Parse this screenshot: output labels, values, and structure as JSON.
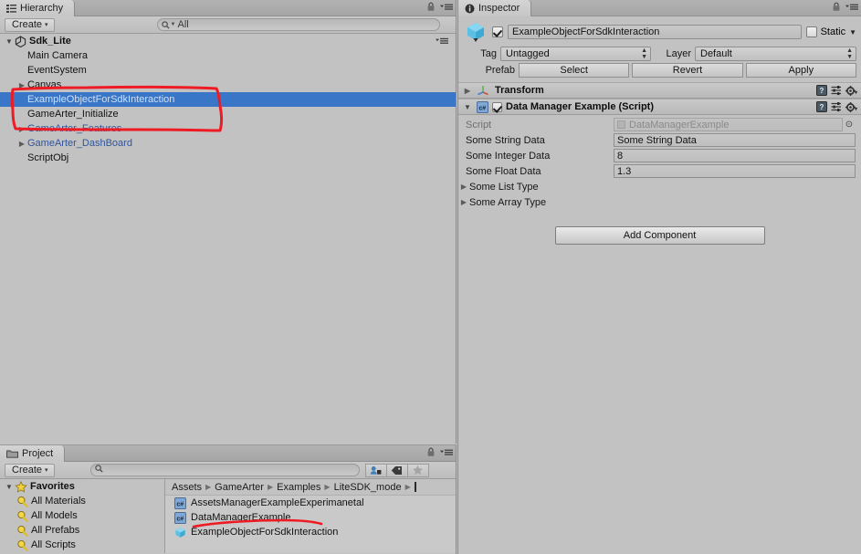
{
  "theme": {
    "accent": "#3a76c8",
    "prefab_text": "#30559a",
    "annotation": "#ee1b24",
    "bg": "#c2c2c2"
  },
  "hierarchy": {
    "tab_label": "Hierarchy",
    "tab_icon": "hierarchy-icon",
    "lock_icon": "lock-icon",
    "menu_icon": "hamburger-menu-icon",
    "create_label": "Create",
    "create_caret": "▾",
    "search_placeholder": "",
    "search_value": "All",
    "search_icon": "search-dropdown-icon",
    "scene_menu_icon": "hamburger-menu-icon",
    "root": {
      "label": "Sdk_Lite",
      "icon": "unity-scene-icon",
      "expanded": true,
      "foldout": "▼"
    },
    "items": [
      {
        "label": "Main Camera",
        "foldout": "",
        "indent": 1,
        "prefab": false,
        "selected": false
      },
      {
        "label": "EventSystem",
        "foldout": "",
        "indent": 1,
        "prefab": false,
        "selected": false
      },
      {
        "label": "Canvas",
        "foldout": "▶",
        "indent": 1,
        "prefab": false,
        "selected": false
      },
      {
        "label": "ExampleObjectForSdkInteraction",
        "foldout": "",
        "indent": 1,
        "prefab": true,
        "selected": true
      },
      {
        "label": "GameArter_Initialize",
        "foldout": "",
        "indent": 1,
        "prefab": false,
        "selected": false
      },
      {
        "label": "GameArter_Features",
        "foldout": "▶",
        "indent": 1,
        "prefab": true,
        "selected": false
      },
      {
        "label": "GameArter_DashBoard",
        "foldout": "▶",
        "indent": 1,
        "prefab": true,
        "selected": false
      },
      {
        "label": "ScriptObj",
        "foldout": "",
        "indent": 1,
        "prefab": false,
        "selected": false
      }
    ]
  },
  "inspector": {
    "tab_label": "Inspector",
    "tab_icon": "info-icon",
    "lock_icon": "lock-icon",
    "menu_icon": "hamburger-menu-icon",
    "object": {
      "icon": "prefab-cube-icon",
      "enabled": true,
      "name": "ExampleObjectForSdkInteraction",
      "static_label": "Static",
      "static_checked": false,
      "static_caret": "▼"
    },
    "tag_label": "Tag",
    "tag_value": "Untagged",
    "layer_label": "Layer",
    "layer_value": "Default",
    "prefab_label": "Prefab",
    "prefab_buttons": [
      "Select",
      "Revert",
      "Apply"
    ],
    "components": [
      {
        "name": "Transform",
        "icon": "transform-axis-icon",
        "foldout": "▶",
        "expanded": false,
        "has_checkbox": false,
        "help_icon": "help-icon",
        "preset_icon": "preset-icon",
        "gear_icon": "gear-icon",
        "properties": []
      },
      {
        "name": "Data Manager Example (Script)",
        "icon": "csharp-script-icon",
        "foldout": "▼",
        "expanded": true,
        "has_checkbox": true,
        "checked": true,
        "help_icon": "help-icon",
        "preset_icon": "preset-icon",
        "gear_icon": "gear-icon",
        "properties": [
          {
            "kind": "object",
            "label": "Script",
            "value": "DataManagerExample",
            "disabled": true,
            "picker_icon": "object-picker-icon"
          },
          {
            "kind": "text",
            "label": "Some String Data",
            "value": "Some String Data",
            "disabled": false
          },
          {
            "kind": "text",
            "label": "Some Integer Data",
            "value": "8",
            "disabled": false
          },
          {
            "kind": "text",
            "label": "Some Float Data",
            "value": "1.3",
            "disabled": false
          },
          {
            "kind": "foldout",
            "label": "Some List Type",
            "foldout": "▶"
          },
          {
            "kind": "foldout",
            "label": "Some Array Type",
            "foldout": "▶"
          }
        ]
      }
    ],
    "add_component_label": "Add Component"
  },
  "project": {
    "tab_label": "Project",
    "tab_icon": "folder-icon",
    "lock_icon": "lock-icon",
    "menu_icon": "hamburger-menu-icon",
    "create_label": "Create",
    "create_caret": "▾",
    "search_placeholder": "",
    "search_value": "",
    "search_icon": "search-icon",
    "filter_buttons": [
      {
        "icon": "filter-by-type-icon"
      },
      {
        "icon": "filter-by-label-icon"
      },
      {
        "icon": "favorite-star-icon"
      }
    ],
    "favorites": {
      "label": "Favorites",
      "icon": "favorite-star-icon",
      "foldout": "▼",
      "items": [
        {
          "label": "All Materials",
          "icon": "search-saved-icon"
        },
        {
          "label": "All Models",
          "icon": "search-saved-icon"
        },
        {
          "label": "All Prefabs",
          "icon": "search-saved-icon"
        },
        {
          "label": "All Scripts",
          "icon": "search-saved-icon"
        }
      ]
    },
    "breadcrumb": [
      "Assets",
      "GameArter",
      "Examples",
      "LiteSDK_mode"
    ],
    "breadcrumb_sep": "▶",
    "breadcrumb_truncated": true,
    "assets": [
      {
        "label": "AssetsManagerExampleExperimanetal",
        "icon": "csharp-script-icon"
      },
      {
        "label": "DataManagerExample",
        "icon": "csharp-script-icon"
      },
      {
        "label": "ExampleObjectForSdkInteraction",
        "icon": "prefab-cube-icon"
      }
    ]
  },
  "annotations": [
    {
      "name": "hierarchy-selection-circle",
      "shape": "freehand-rect",
      "color": "#ee1b24"
    },
    {
      "name": "project-asset-underline",
      "shape": "freehand-line",
      "color": "#ee1b24"
    }
  ]
}
